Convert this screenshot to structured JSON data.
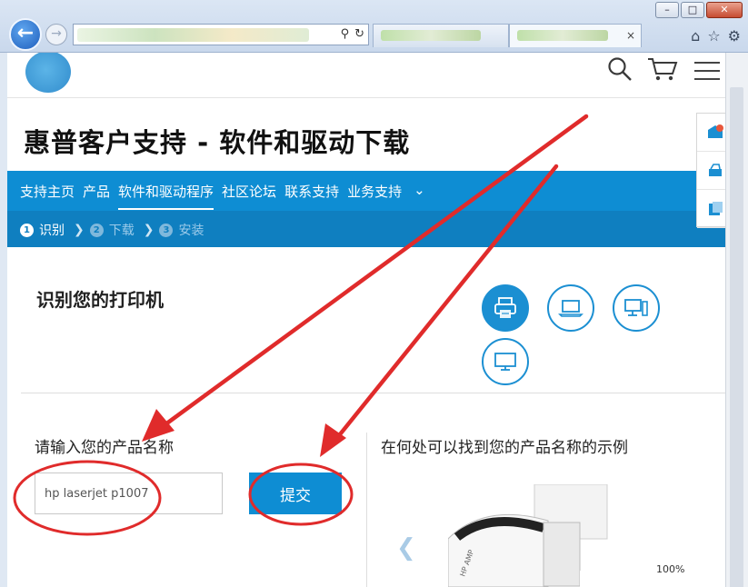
{
  "browser": {
    "back_icon": "arrow-left-icon",
    "forward_icon": "arrow-right-icon",
    "address_icons": [
      "search-icon",
      "refresh-icon"
    ],
    "tab_close": "×",
    "toolbar_icons": [
      "home-icon",
      "star-icon",
      "gear-icon"
    ],
    "window_controls": {
      "minimize": "–",
      "maximize": "□",
      "close": "✕"
    },
    "zoom_level": "100%"
  },
  "page": {
    "title": "惠普客户支持 - 软件和驱动下载",
    "nav": {
      "items": [
        {
          "label": "支持主页",
          "active": false
        },
        {
          "label": "产品",
          "active": false
        },
        {
          "label": "软件和驱动程序",
          "active": true
        },
        {
          "label": "社区论坛",
          "active": false
        },
        {
          "label": "联系支持",
          "active": false
        },
        {
          "label": "业务支持",
          "active": false
        }
      ],
      "more_icon": "chevron-down-icon"
    },
    "steps": [
      {
        "num": "1",
        "label": "识别",
        "active": true
      },
      {
        "num": "2",
        "label": "下载",
        "active": false
      },
      {
        "num": "3",
        "label": "安装",
        "active": false
      }
    ],
    "identify_heading": "识别您的打印机",
    "device_icons": [
      "printer-icon",
      "laptop-icon",
      "desktop-icon",
      "monitor-icon"
    ],
    "input_label": "请输入您的产品名称",
    "input_value": "hp laserjet p1007",
    "submit_label": "提交",
    "example_label": "在何处可以找到您的产品名称的示例",
    "example_caption": "HP AMP"
  },
  "colors": {
    "nav_blue": "#0e8dd3",
    "step_blue": "#0f7fc0",
    "annotation_red": "#e02b2b"
  }
}
